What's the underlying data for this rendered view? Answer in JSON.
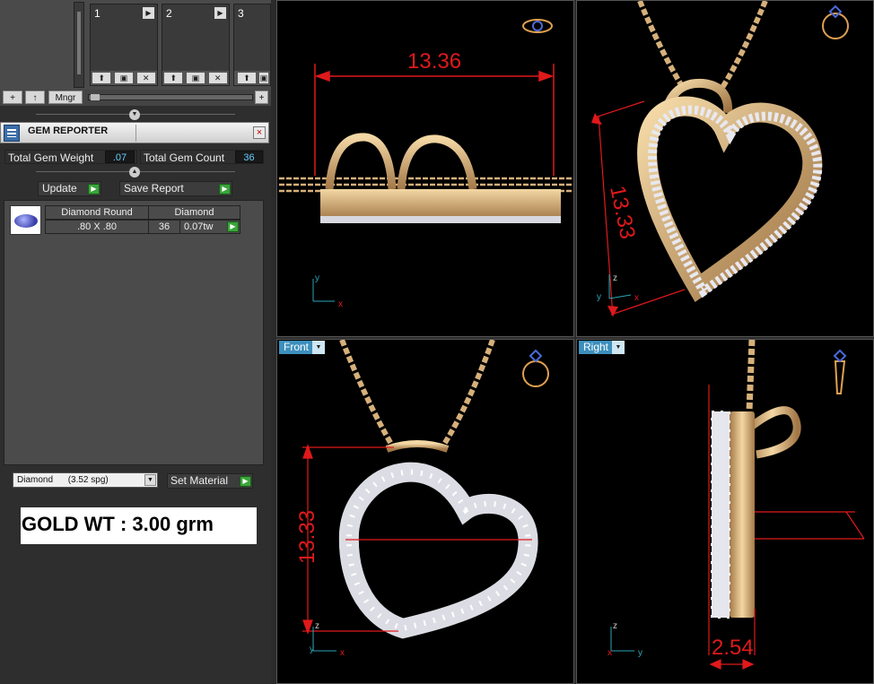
{
  "slots": [
    {
      "number": "1"
    },
    {
      "number": "2"
    },
    {
      "number": "3"
    }
  ],
  "toolbar": {
    "add_label": "+",
    "up_label": "↑",
    "manager_label": "Mngr",
    "add_right_label": "+"
  },
  "gem_reporter": {
    "title": "GEM REPORTER",
    "close_label": "×",
    "total_weight_label": "Total Gem Weight",
    "total_weight_value": ".07",
    "total_count_label": "Total Gem Count",
    "total_count_value": "36",
    "update_label": "Update",
    "save_report_label": "Save Report",
    "table": {
      "col1_header": "Diamond Round",
      "col2_header": "Diamond",
      "size": ".80 X .80",
      "count": "36",
      "weight": "0.07tw"
    }
  },
  "material": {
    "selected": "Diamond      (3.52 spg)",
    "set_label": "Set Material"
  },
  "gold_weight": "GOLD WT : 3.00 grm",
  "viewports": {
    "front_label": "Front",
    "right_label": "Right"
  },
  "dimensions": {
    "top_width": "13.36",
    "persp_height": "13.33",
    "front_height": "13.33",
    "right_depth": "2.54"
  },
  "axes": {
    "x": "x",
    "y": "y",
    "z": "z"
  },
  "colors": {
    "viewport_label_bg": "#3d8fbd",
    "dimension_red": "#e0191b",
    "gold": "#c9a06a",
    "diamond": "#e8e8f0",
    "go_green": "#3aa53a"
  }
}
